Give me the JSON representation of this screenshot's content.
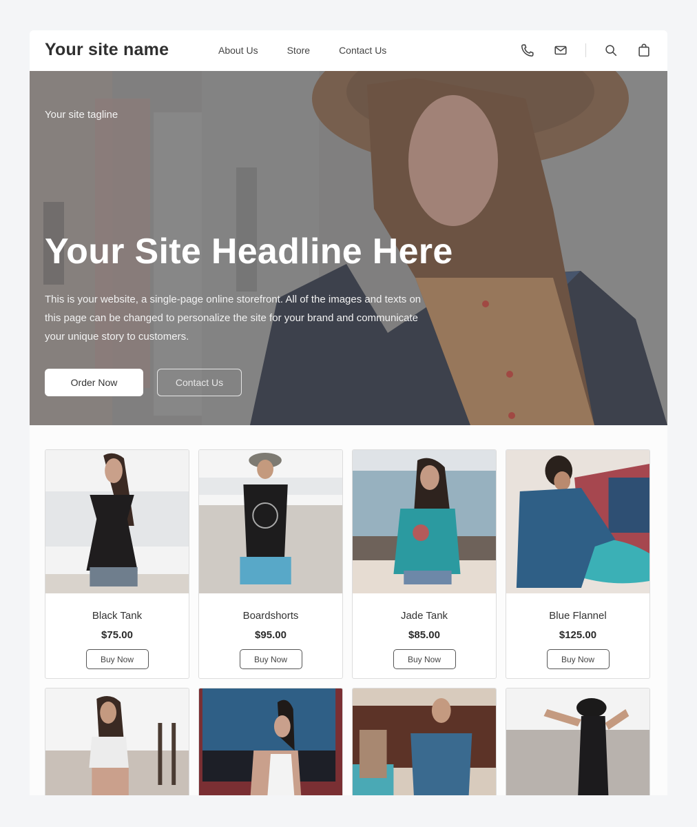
{
  "header": {
    "site_name": "Your site name",
    "nav": [
      {
        "label": "About Us"
      },
      {
        "label": "Store"
      },
      {
        "label": "Contact Us"
      }
    ],
    "icons": [
      "phone-icon",
      "mail-icon",
      "search-icon",
      "shopping-bag-icon"
    ]
  },
  "hero": {
    "tagline": "Your site tagline",
    "headline": "Your Site Headline Here",
    "description": "This is your website, a single-page online storefront. All of the images and texts on this page can be changed to personalize the site for your brand and communicate your unique story to customers.",
    "primary_button": "Order Now",
    "secondary_button": "Contact Us"
  },
  "products": [
    {
      "name": "Black Tank",
      "price": "$75.00",
      "button": "Buy Now"
    },
    {
      "name": "Boardshorts",
      "price": "$95.00",
      "button": "Buy Now"
    },
    {
      "name": "Jade Tank",
      "price": "$85.00",
      "button": "Buy Now"
    },
    {
      "name": "Blue Flannel",
      "price": "$125.00",
      "button": "Buy Now"
    }
  ],
  "colors": {
    "page_background": "#f4f5f7",
    "text_dark": "#2f2f2f",
    "hero_overlay": "#7d7b79"
  }
}
